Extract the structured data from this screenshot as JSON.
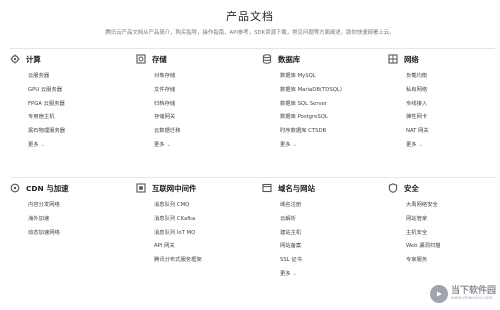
{
  "header": {
    "title": "产品文档",
    "subtitle": "腾讯云产品文档从产品简介，购买指导，操作指南，API参考，SDK资源下载，常见问题等方面阐述，助你快速部署上云。"
  },
  "categories": [
    {
      "icon": "settings-icon",
      "title": "计算",
      "items": [
        "云服务器",
        "GPU 云服务器",
        "FPGA 云服务器",
        "专用宿主机",
        "黑石物理服务器"
      ],
      "more": "更多"
    },
    {
      "icon": "gear-box-icon",
      "title": "存储",
      "items": [
        "对象存储",
        "文件存储",
        "归档存储",
        "存储网关",
        "云数据迁移"
      ],
      "more": "更多"
    },
    {
      "icon": "database-icon",
      "title": "数据库",
      "items": [
        "数据库 MySQL",
        "数据库 MariaDB(TDSQL)",
        "数据库 SQL Server",
        "数据库 PostgreSQL",
        "时序数据库 CTSDB"
      ],
      "more": "更多"
    },
    {
      "icon": "network-icon",
      "title": "网络",
      "items": [
        "负载均衡",
        "私有网络",
        "专线接入",
        "弹性网卡",
        "NAT 网关"
      ],
      "more": "更多"
    },
    {
      "icon": "cdn-icon",
      "title": "CDN 与加速",
      "items": [
        "内容分发网络",
        "海外加速",
        "动态加速网络"
      ],
      "more": ""
    },
    {
      "icon": "middleware-icon",
      "title": "互联网中间件",
      "items": [
        "消息队列 CMQ",
        "消息队列 CKafka",
        "消息队列 IoT MQ",
        "API 网关",
        "腾讯分布式服务框架"
      ],
      "more": ""
    },
    {
      "icon": "domain-icon",
      "title": "域名与网站",
      "items": [
        "域名注册",
        "云解析",
        "建站主机",
        "网站备案",
        "SSL 证书"
      ],
      "more": "更多"
    },
    {
      "icon": "shield-icon",
      "title": "安全",
      "items": [
        "大禹网络安全",
        "网站管家",
        "主机安全",
        "Web 漏洞扫描",
        "专家服务"
      ],
      "more": ""
    }
  ],
  "watermark": {
    "main": "当下软件园",
    "sub": "www.downxia.com"
  },
  "colors": {
    "text": "#444444",
    "title": "#222222",
    "divider": "#e6e6e6",
    "icon": "#555555"
  }
}
